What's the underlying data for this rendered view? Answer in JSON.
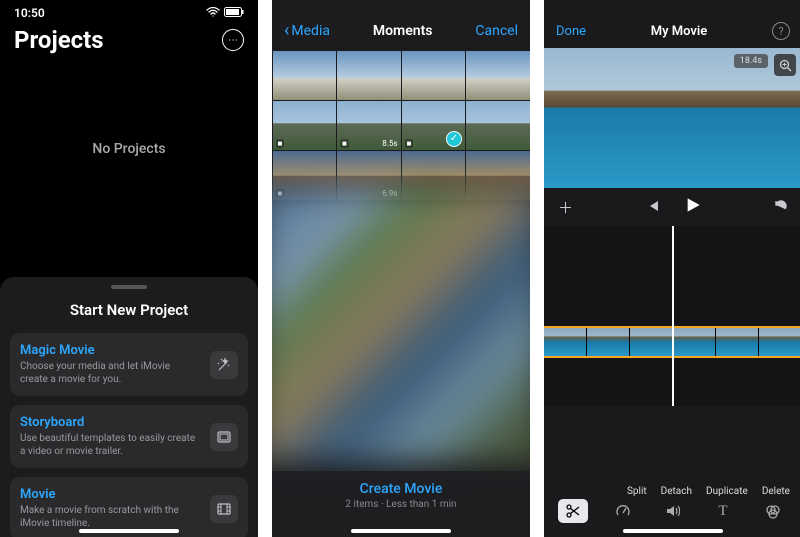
{
  "screen1": {
    "status": {
      "time": "10:50"
    },
    "title": "Projects",
    "empty_text": "No Projects",
    "sheet": {
      "title": "Start New Project",
      "options": [
        {
          "title": "Magic Movie",
          "desc": "Choose your media and let iMovie create a movie for you."
        },
        {
          "title": "Storyboard",
          "desc": "Use beautiful templates to easily create a video or movie trailer."
        },
        {
          "title": "Movie",
          "desc": "Make a movie from scratch with the iMovie timeline."
        }
      ]
    }
  },
  "screen2": {
    "nav": {
      "back": "Media",
      "title": "Moments",
      "cancel": "Cancel"
    },
    "thumbs": {
      "row2": {
        "c2_dur": "8.5s"
      },
      "row3": {
        "c2_dur": "6.9s"
      }
    },
    "create": {
      "label": "Create Movie",
      "sub": "2 items · Less than 1 min"
    }
  },
  "screen3": {
    "nav": {
      "done": "Done",
      "title": "My Movie"
    },
    "preview": {
      "duration": "18.4s"
    },
    "clip_actions": {
      "split": "Split",
      "detach": "Detach",
      "duplicate": "Duplicate",
      "delete": "Delete"
    }
  }
}
